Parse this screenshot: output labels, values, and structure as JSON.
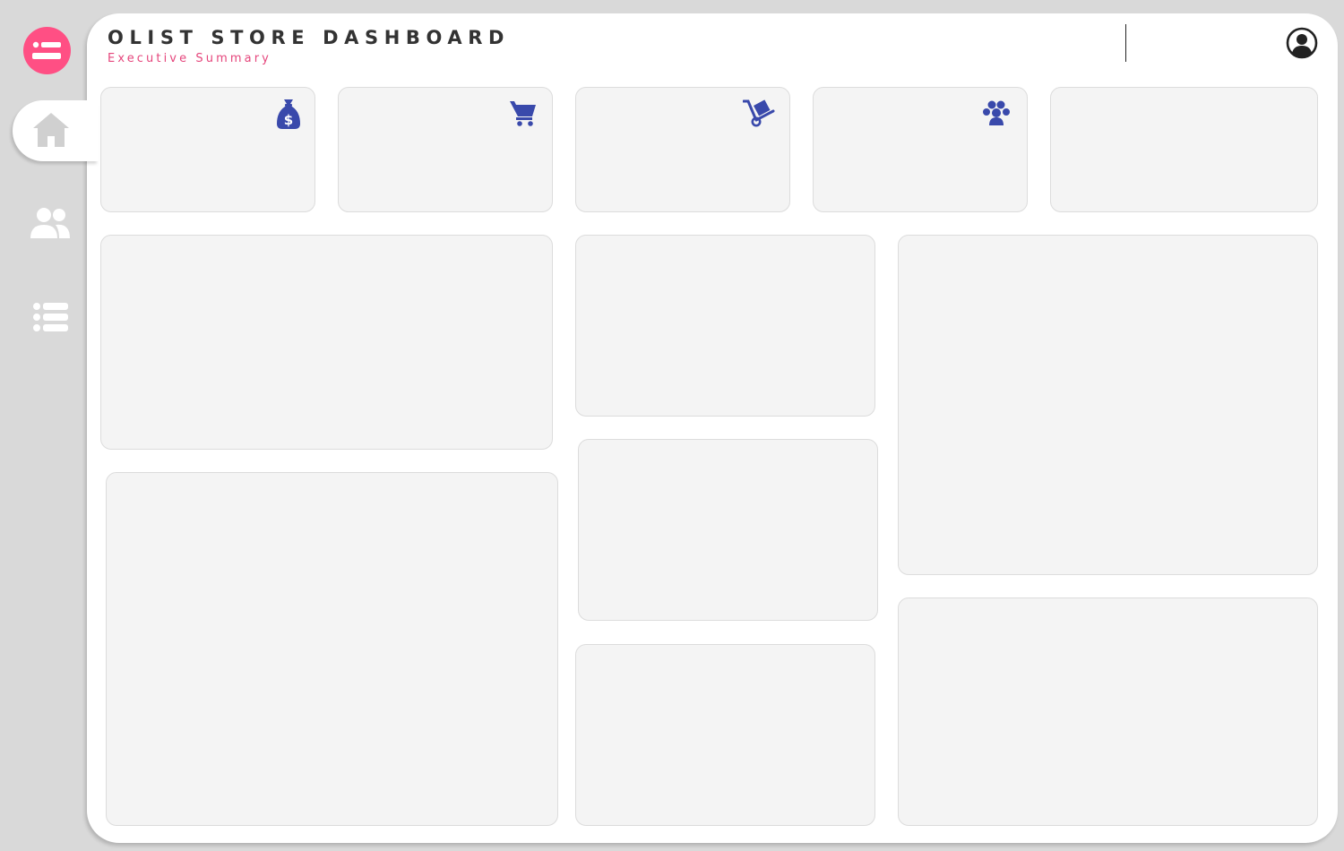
{
  "header": {
    "title": "OLIST STORE DASHBOARD",
    "subtitle": "Executive Summary"
  },
  "colors": {
    "background": "#d9d9d9",
    "panel": "#ffffff",
    "accent_pink": "#ff4f84",
    "subtitle_pink": "#e5467c",
    "kpi_icon_blue": "#3949ab",
    "card_fill": "#f4f4f4",
    "nav_icon_inactive": "#ffffff",
    "nav_icon_active": "#d0d0d0"
  },
  "sidebar": {
    "menu_icon": "menu-list-icon",
    "items": [
      {
        "icon": "home-icon",
        "active": true
      },
      {
        "icon": "users-icon",
        "active": false
      },
      {
        "icon": "list-icon",
        "active": false
      }
    ]
  },
  "kpi_cards": [
    {
      "icon": "money-bag-icon"
    },
    {
      "icon": "shopping-cart-icon"
    },
    {
      "icon": "hand-truck-icon"
    },
    {
      "icon": "customers-group-icon"
    },
    {
      "icon": ""
    }
  ],
  "user_icon": "user-circle-icon"
}
